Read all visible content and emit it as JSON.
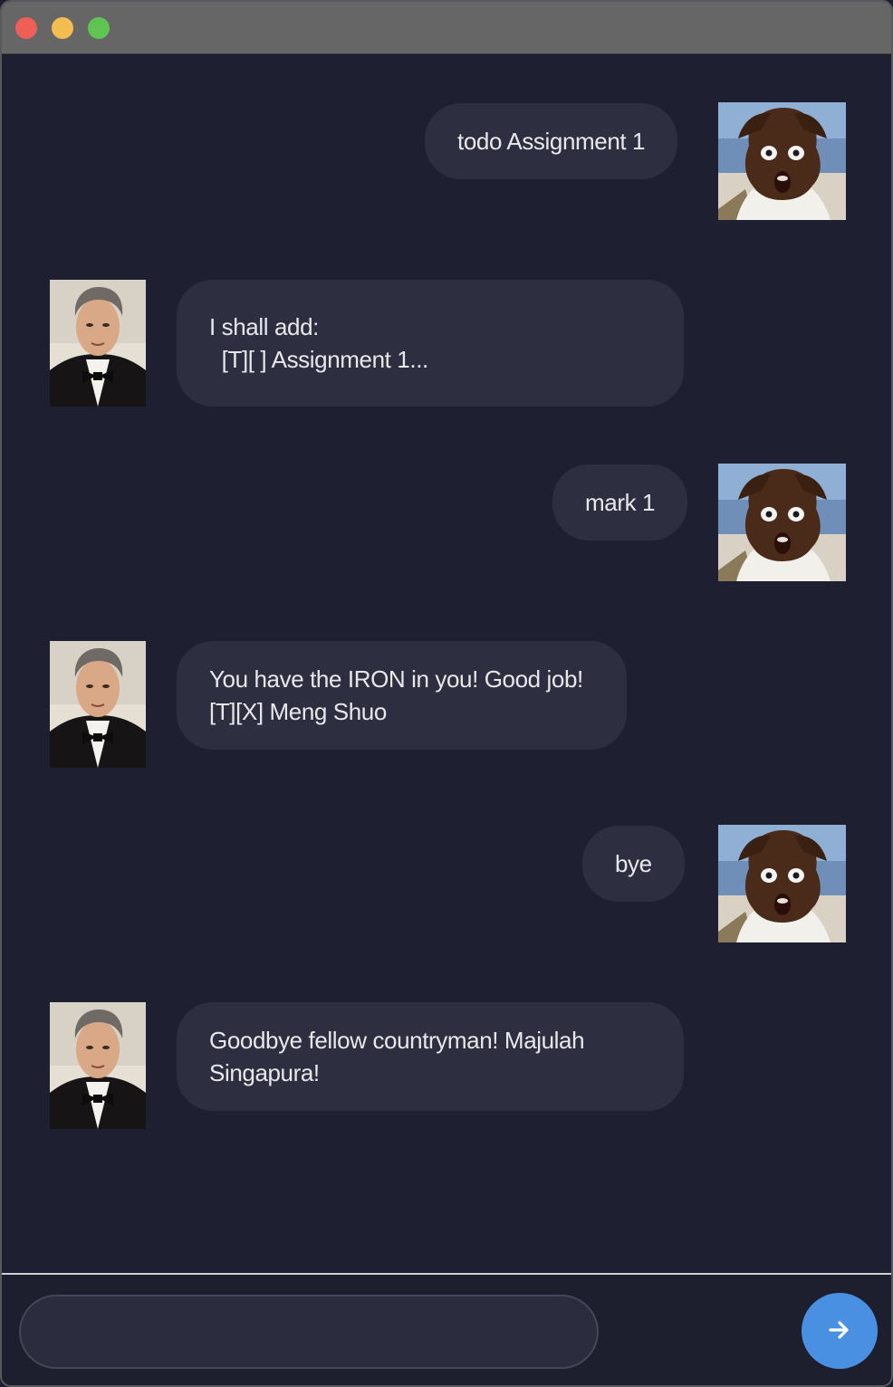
{
  "window": {
    "controls": {
      "close_color": "#ed5f57",
      "minimize_color": "#f4bd4f",
      "maximize_color": "#60c453"
    }
  },
  "messages": [
    {
      "sender": "user",
      "text": "todo Assignment 1"
    },
    {
      "sender": "bot",
      "text": "I shall add:\n  [T][ ] Assignment 1..."
    },
    {
      "sender": "user",
      "text": "mark 1"
    },
    {
      "sender": "bot",
      "text": "You have the IRON in you! Good job!\n[T][X] Meng Shuo"
    },
    {
      "sender": "user",
      "text": "bye"
    },
    {
      "sender": "bot",
      "text": "Goodbye fellow countryman! Majulah\nSingapura!"
    }
  ],
  "input": {
    "value": "",
    "placeholder": ""
  },
  "send_button": {
    "icon": "arrow-right-icon",
    "color": "#4a90e2"
  },
  "avatars": {
    "user": "user-avatar-photo",
    "bot": "bot-avatar-photo"
  }
}
